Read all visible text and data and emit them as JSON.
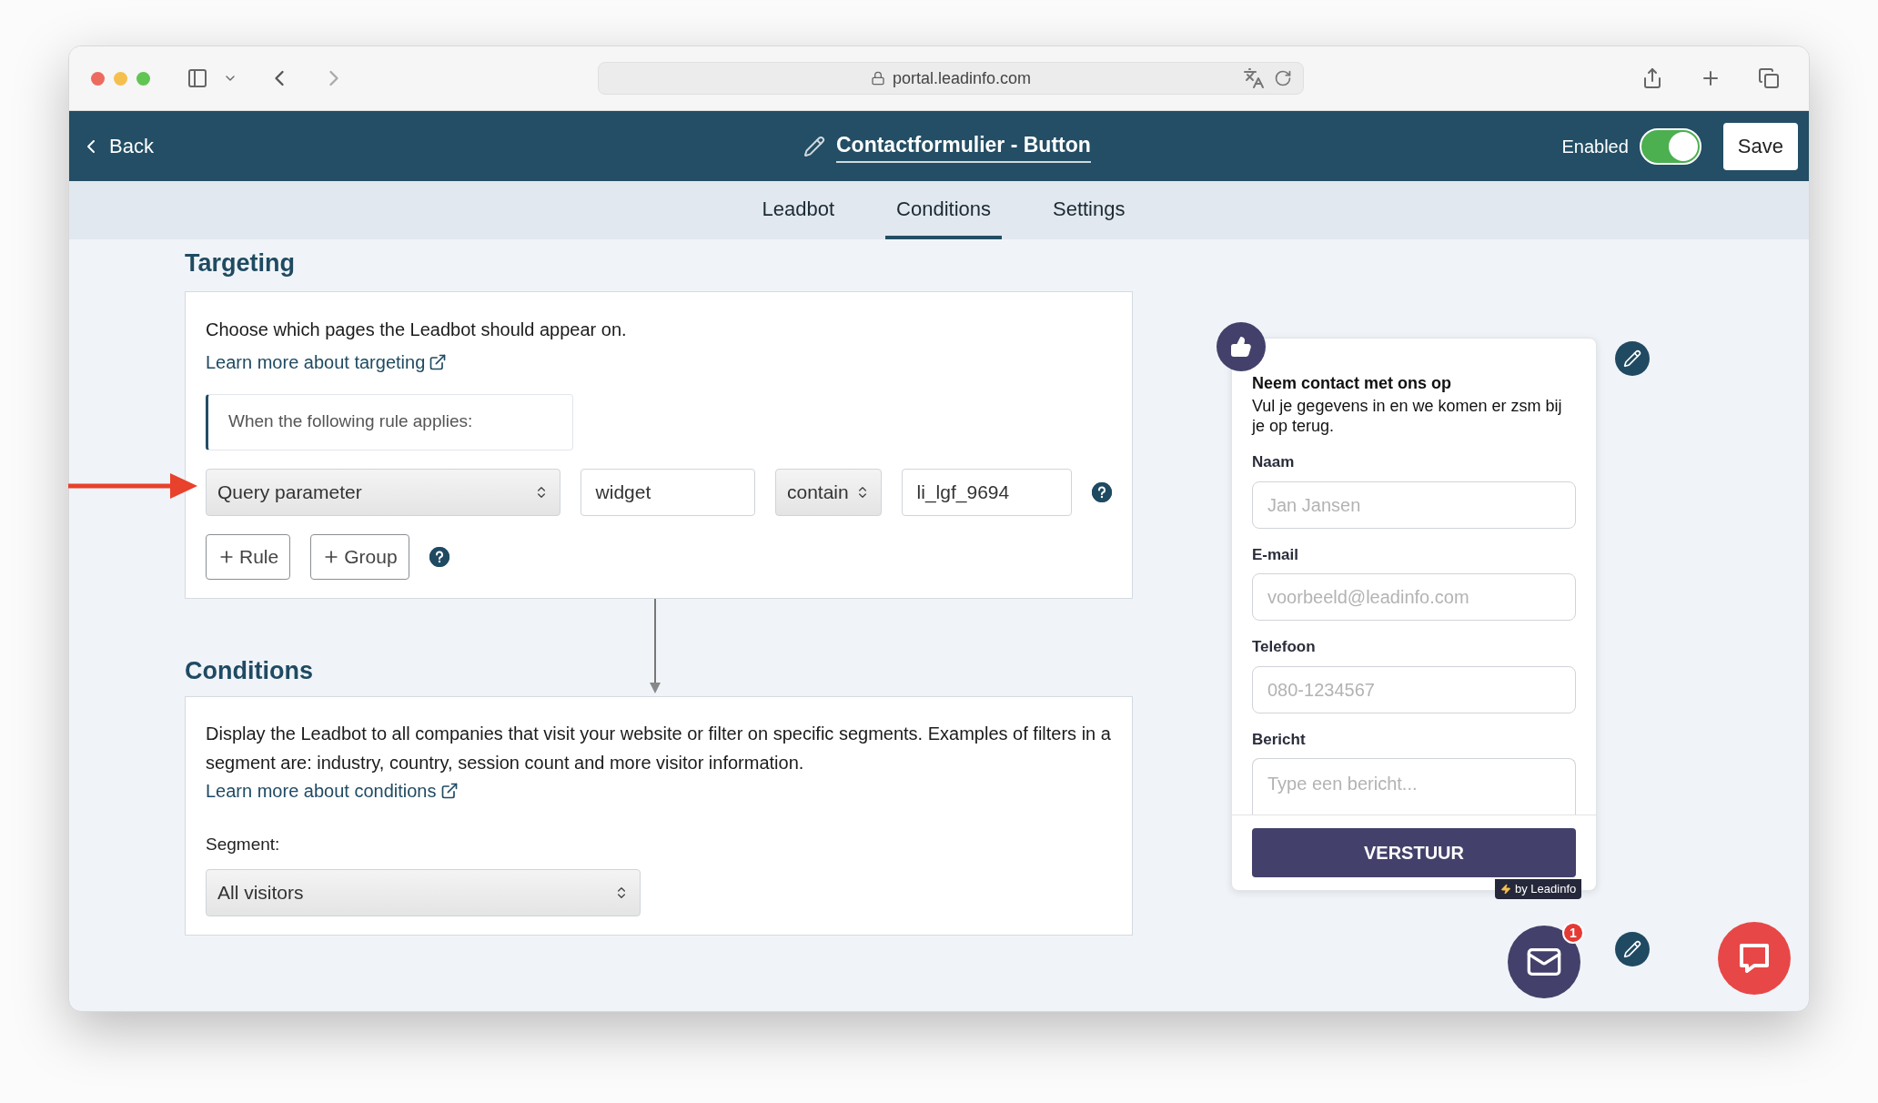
{
  "browser": {
    "url": "portal.leadinfo.com"
  },
  "header": {
    "back_label": "Back",
    "title": "Contactformulier - Button",
    "enabled_label": "Enabled",
    "enabled": true,
    "save_label": "Save"
  },
  "tabs": [
    {
      "label": "Leadbot",
      "selected": false
    },
    {
      "label": "Conditions",
      "selected": true
    },
    {
      "label": "Settings",
      "selected": false
    }
  ],
  "targeting": {
    "heading": "Targeting",
    "description": "Choose which pages the Leadbot should appear on.",
    "link": "Learn more about targeting",
    "rule_group_label": "When the following rule applies:",
    "rule": {
      "field": "Query parameter",
      "key": "widget",
      "operator": "contain",
      "value": "li_lgf_9694"
    },
    "buttons": [
      "Rule",
      "Group"
    ]
  },
  "conditions": {
    "heading": "Conditions",
    "description": "Display the Leadbot to all companies that visit your website or filter on specific segments. Examples of filters in a segment are: industry, country, session count and more visitor information.",
    "link": "Learn more about conditions",
    "segment_label": "Segment:",
    "segment_value": "All visitors"
  },
  "widget": {
    "title": "Neem contact met ons op",
    "subtitle": "Vul je gegevens in en we komen er zsm bij je op terug.",
    "fields": [
      {
        "label": "Naam",
        "placeholder": "Jan Jansen",
        "kind": "input"
      },
      {
        "label": "E-mail",
        "placeholder": "voorbeeld@leadinfo.com",
        "kind": "input"
      },
      {
        "label": "Telefoon",
        "placeholder": "080-1234567",
        "kind": "input"
      },
      {
        "label": "Bericht",
        "placeholder": "Type een bericht...",
        "kind": "textarea"
      }
    ],
    "submit": "VERSTUUR",
    "branding": "by Leadinfo"
  },
  "mail_button": {
    "badge": "1"
  }
}
